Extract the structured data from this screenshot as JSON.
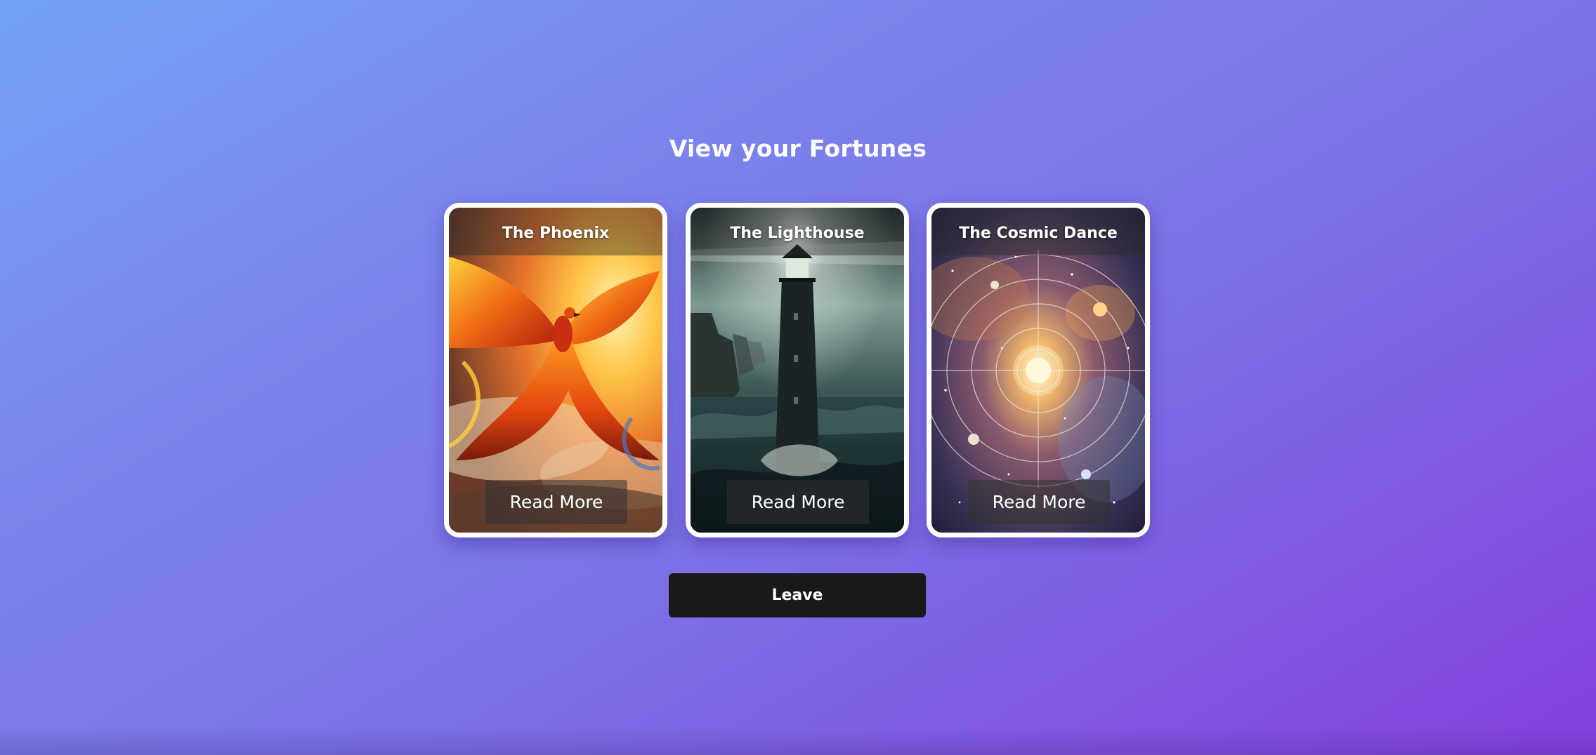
{
  "page": {
    "title": "View your Fortunes"
  },
  "cards": [
    {
      "title": "The Phoenix",
      "button_label": "Read More",
      "image": "phoenix-art"
    },
    {
      "title": "The Lighthouse",
      "button_label": "Read More",
      "image": "lighthouse-art"
    },
    {
      "title": "The Cosmic Dance",
      "button_label": "Read More",
      "image": "cosmic-dance-art"
    }
  ],
  "actions": {
    "leave_label": "Leave"
  },
  "colors": {
    "background_start": "#74a3f3",
    "background_end": "#8540dd",
    "card_border": "#ffffff",
    "leave_button": "#191919",
    "text": "#ffffff"
  }
}
